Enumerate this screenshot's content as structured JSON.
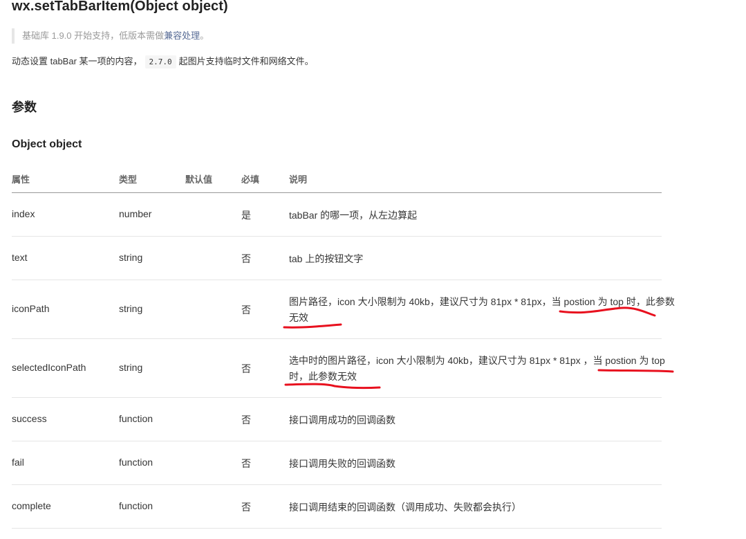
{
  "page": {
    "title": "wx.setTabBarItem(Object object)",
    "note_prefix": "基础库 1.9.0 开始支持，低版本需做",
    "note_link": "兼容处理",
    "note_suffix": "。",
    "desc_prefix": "动态设置 tabBar 某一项的内容，",
    "desc_code": "2.7.0",
    "desc_suffix": "起图片支持临时文件和网络文件。",
    "section_params": "参数",
    "section_object": "Object object"
  },
  "table": {
    "headers": {
      "name": "属性",
      "type": "类型",
      "default": "默认值",
      "required": "必填",
      "desc": "说明"
    },
    "rows": [
      {
        "name": "index",
        "type": "number",
        "default": "",
        "required": "是",
        "desc": "tabBar 的哪一项，从左边算起"
      },
      {
        "name": "text",
        "type": "string",
        "default": "",
        "required": "否",
        "desc": "tab 上的按钮文字"
      },
      {
        "name": "iconPath",
        "type": "string",
        "default": "",
        "required": "否",
        "desc": "图片路径，icon 大小限制为 40kb，建议尺寸为 81px * 81px，当 postion 为 top 时，此参数无效"
      },
      {
        "name": "selectedIconPath",
        "type": "string",
        "default": "",
        "required": "否",
        "desc": "选中时的图片路径，icon 大小限制为 40kb，建议尺寸为 81px * 81px ，当 postion 为 top 时，此参数无效"
      },
      {
        "name": "success",
        "type": "function",
        "default": "",
        "required": "否",
        "desc": "接口调用成功的回调函数"
      },
      {
        "name": "fail",
        "type": "function",
        "default": "",
        "required": "否",
        "desc": "接口调用失败的回调函数"
      },
      {
        "name": "complete",
        "type": "function",
        "default": "",
        "required": "否",
        "desc": "接口调用结束的回调函数（调用成功、失败都会执行）"
      }
    ]
  },
  "annotation": {
    "color": "#e8101e"
  }
}
